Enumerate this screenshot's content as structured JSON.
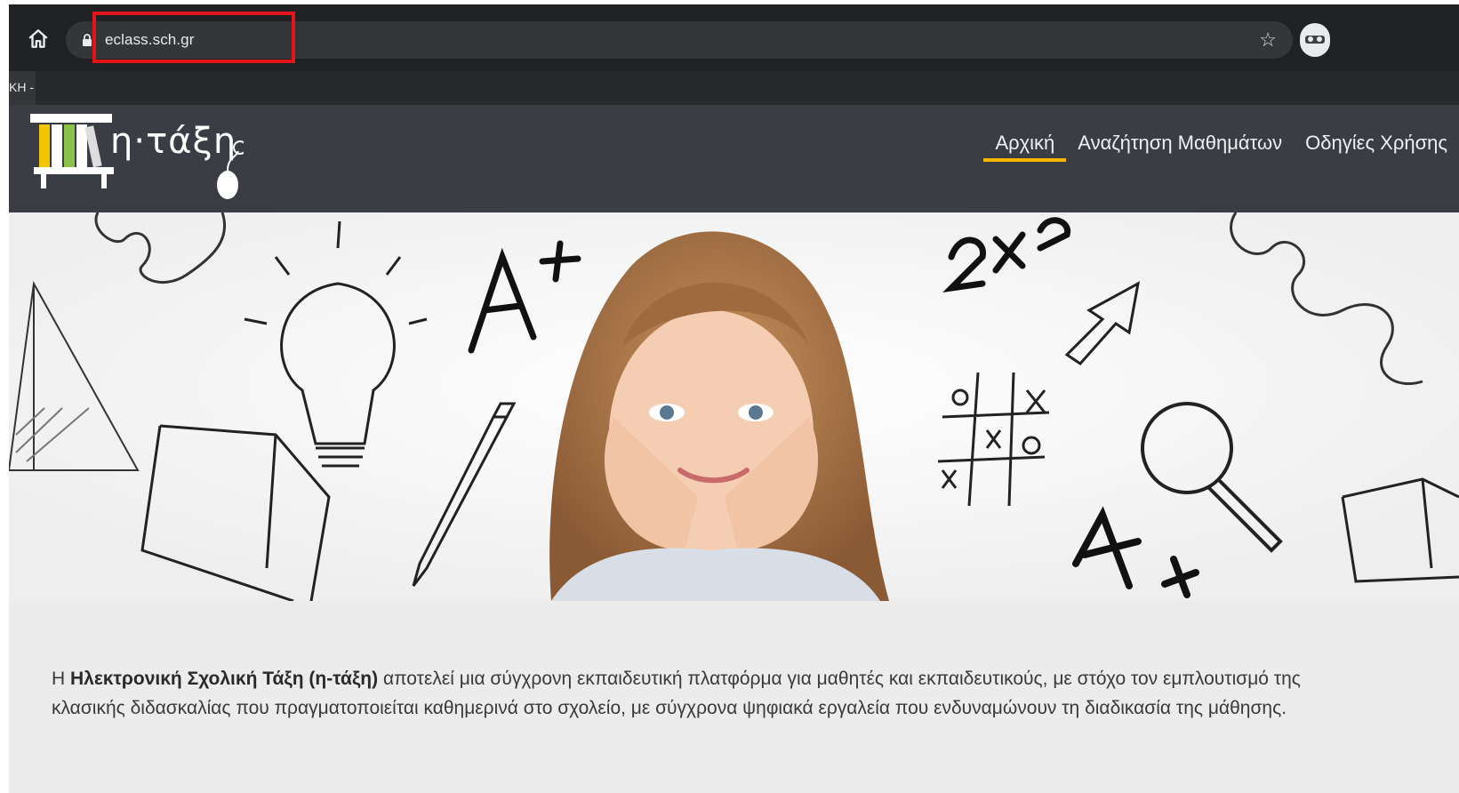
{
  "browser": {
    "url": "eclass.sch.gr",
    "bookmark_text": "ΚΗ -"
  },
  "site": {
    "logo_text": "η·τάξη",
    "nav": [
      {
        "label": "Αρχική",
        "active": true
      },
      {
        "label": "Αναζήτηση Μαθημάτων",
        "active": false
      },
      {
        "label": "Οδηγίες Χρήσης",
        "active": false
      }
    ],
    "nav_accent": "#f4b400",
    "header_bg": "#3a3d43"
  },
  "info": {
    "prefix": "Η ",
    "bold": "Ηλεκτρονική Σχολική Τάξη (η-τάξη)",
    "text": " αποτελεί μια σύγχρονη εκπαιδευτική πλατφόρμα για μαθητές και εκπαιδευτικούς, με στόχο τον εμπλουτισμό της κλασικής διδασκαλίας που πραγματοποιείται καθημερινά στο σχολείο, με σύγχρονα ψηφιακά εργαλεία που ενδυναμώνουν τη διαδικασία της μάθησης."
  },
  "hero": {
    "doodles": [
      "A+",
      "2x2",
      "x",
      "o"
    ]
  }
}
